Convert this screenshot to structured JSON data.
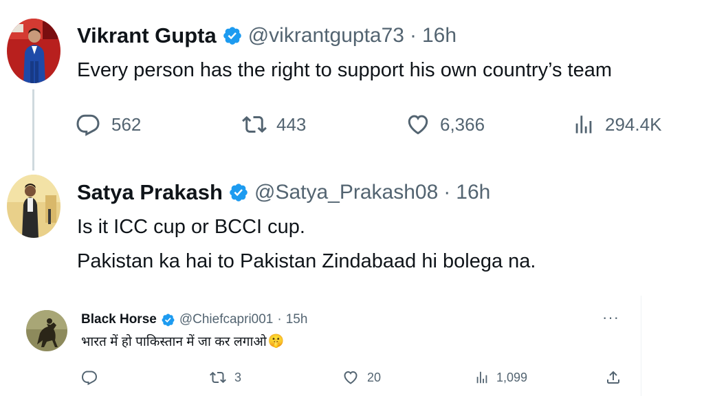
{
  "tweets": [
    {
      "author": "Vikrant Gupta",
      "handle": "@vikrantgupta73",
      "separator": "·",
      "time": "16h",
      "text": "Every person has the right to support his own country’s team",
      "replies": "562",
      "retweets": "443",
      "likes": "6,366",
      "views": "294.4K"
    },
    {
      "author": "Satya Prakash",
      "handle": "@Satya_Prakash08",
      "separator": "·",
      "time": "16h",
      "text_lines": [
        "Is it ICC cup or BCCI cup.",
        "Pakistan ka hai to Pakistan Zindabaad hi bolega na."
      ]
    },
    {
      "author": "Black Horse",
      "handle": "@Chiefcapri001",
      "separator": "·",
      "time": "15h",
      "text": "भारत में हो पाकिस्तान में जा कर लगाओ",
      "emoji": "🤫",
      "more": "···",
      "retweets": "3",
      "likes": "20",
      "views": "1,099"
    }
  ],
  "icons": {
    "verified": "verified-badge-icon",
    "reply": "reply-icon",
    "retweet": "retweet-icon",
    "like": "heart-icon",
    "views": "views-icon",
    "share": "share-icon"
  },
  "colors": {
    "verified_blue": "#1d9bf0",
    "text_primary": "#0f1419",
    "text_secondary": "#536471",
    "thread_line": "#cfd9de"
  }
}
